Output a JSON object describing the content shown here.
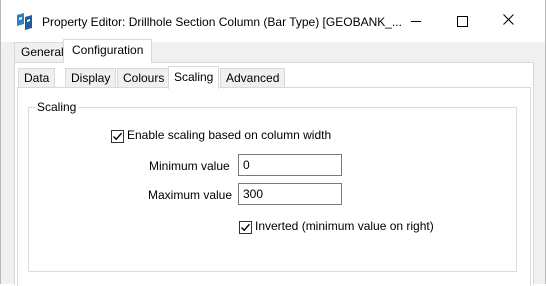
{
  "window": {
    "title": "Property Editor: Drillhole Section Column (Bar Type) [GEOBANK_...",
    "icon": "property-editor-app-icon"
  },
  "window_controls": {
    "minimize": "minimize-icon",
    "maximize": "maximize-icon",
    "close": "close-icon"
  },
  "outer_tabs": [
    {
      "label": "General",
      "selected": false
    },
    {
      "label": "Configuration",
      "selected": true
    }
  ],
  "inner_tabs": [
    {
      "label": "Data",
      "selected": false
    },
    {
      "label": "Display",
      "selected": false
    },
    {
      "label": "Colours",
      "selected": false
    },
    {
      "label": "Scaling",
      "selected": true
    },
    {
      "label": "Advanced",
      "selected": false
    }
  ],
  "scaling_group": {
    "label": "Scaling",
    "enable_scaling": {
      "label": "Enable scaling based on column width",
      "checked": true
    },
    "minimum": {
      "label": "Minimum value",
      "value": "0"
    },
    "maximum": {
      "label": "Maximum value",
      "value": "300"
    },
    "inverted": {
      "label": "Inverted (minimum value on right)",
      "checked": true
    }
  },
  "colors": {
    "accent": "#0078d7",
    "panel": "#ffffff",
    "chrome": "#f0f0f0"
  }
}
